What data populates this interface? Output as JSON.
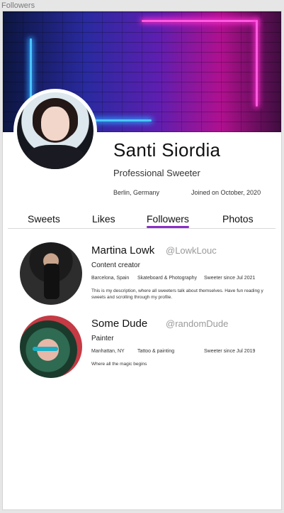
{
  "frame_label": "Followers",
  "profile": {
    "name": "Santi Siordia",
    "title": "Professional Sweeter",
    "location": "Berlin, Germany",
    "joined": "Joined on October, 2020"
  },
  "tabs": [
    {
      "label": "Sweets",
      "active": false
    },
    {
      "label": "Likes",
      "active": false
    },
    {
      "label": "Followers",
      "active": true
    },
    {
      "label": "Photos",
      "active": false
    }
  ],
  "followers": [
    {
      "name": "Martina Lowk",
      "handle": "@LowkLouc",
      "role": "Content creator",
      "location": "Barcelona, Spain",
      "interests": "Skateboard & Photography",
      "since": "Sweeter since Jul 2021",
      "description": "This is my description, where all sweeters talk about themselves. Have fun reading y sweets and scrolling through my profile."
    },
    {
      "name": "Some Dude",
      "handle": "@randomDude",
      "role": "Painter",
      "location": "Manhattan, NY",
      "interests": "Tattoo & painting",
      "since": "Sweeter since Jul 2019",
      "description": "Where all the magic begins"
    }
  ],
  "colors": {
    "accent": "#8a2fc4",
    "handle": "#9a9a9a",
    "frame_bg": "#e6e6e6"
  }
}
